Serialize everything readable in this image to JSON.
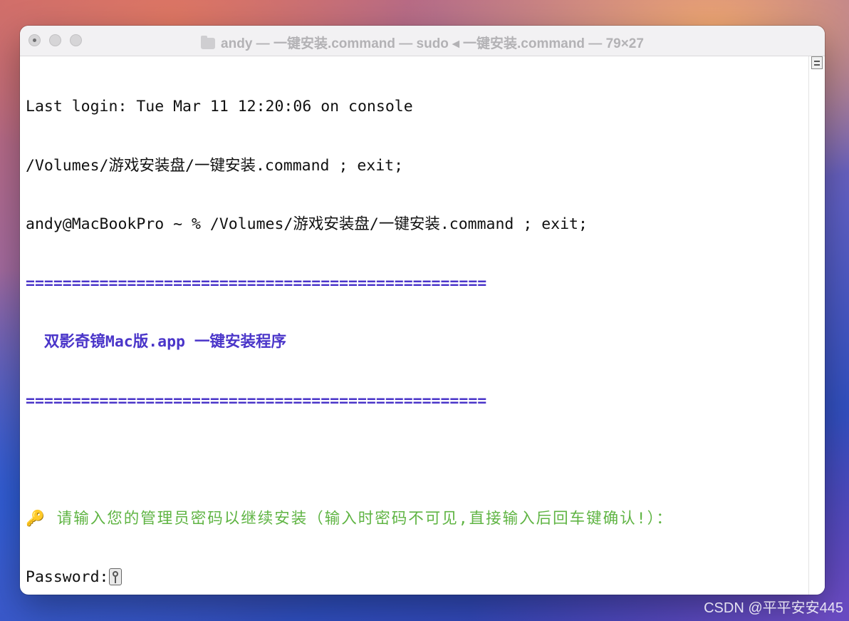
{
  "window": {
    "title": "andy — 一键安装.command — sudo ◂ 一键安装.command — 79×27"
  },
  "terminal": {
    "lines": [
      "Last login: Tue Mar 11 12:20:06 on console",
      "/Volumes/游戏安装盘/一键安装.command ; exit;",
      "andy@MacBookPro ~ % /Volumes/游戏安装盘/一键安装.command ; exit;"
    ],
    "separator": "==================================================",
    "banner": "  双影奇镜Mac版.app 一键安装程序",
    "separator2": "==================================================",
    "prompt_icon": "🔑",
    "prompt": " 请输入您的管理员密码以继续安装（输入时密码不可见,直接输入后回车键确认!）：",
    "password_label": "Password:"
  },
  "colors": {
    "banner": "#4a35c9",
    "prompt": "#5fb443"
  },
  "watermark": "CSDN @平平安安445"
}
